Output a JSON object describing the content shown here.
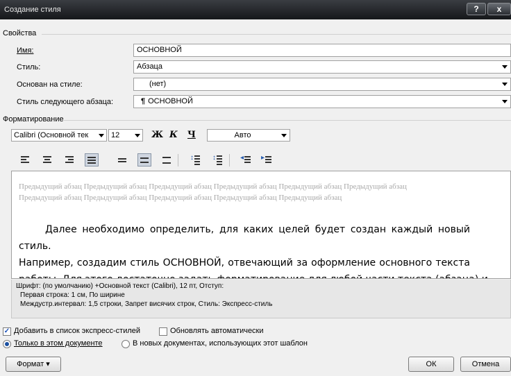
{
  "window": {
    "title": "Создание стиля",
    "help_label": "?",
    "close_label": "x"
  },
  "properties": {
    "section_title": "Свойства",
    "name_label": "Имя:",
    "name_value": "ОСНОВНОЙ",
    "style_label": "Стиль:",
    "style_value": "Абзаца",
    "based_on_label": "Основан на стиле:",
    "based_on_value": "(нет)",
    "next_style_label": "Стиль следующего абзаца:",
    "next_style_glyph": "¶",
    "next_style_value": "ОСНОВНОЙ"
  },
  "formatting": {
    "section_title": "Форматирование",
    "font_value": "Calibri (Основной тек",
    "size_value": "12",
    "bold_label": "Ж",
    "italic_label": "К",
    "underline_label": "Ч",
    "color_value": "Авто"
  },
  "preview": {
    "previous_paragraph": "Предыдущий абзац Предыдущий абзац Предыдущий абзац Предыдущий абзац Предыдущий абзац Предыдущий абзац Предыдущий абзац Предыдущий абзац Предыдущий абзац Предыдущий абзац Предыдущий абзац",
    "line1": "Далее необходимо определить, для каких целей будет создан каждый новый стиль.",
    "line2": "Например, создадим стиль ОСНОВНОЙ, отвечающий за оформление основного текста",
    "line3": "работы. Для этого достаточно задать форматирование для любой части текста (абзаца) и"
  },
  "description": {
    "line1": "Шрифт: (по умолчанию) +Основной текст (Calibri), 12 пт, Отступ:",
    "line2": "Первая строка:  1 см, По ширине",
    "line3": "Междустр.интервал:  1,5 строки, Запрет висячих строк, Стиль: Экспресс-стиль"
  },
  "options": {
    "add_to_quick_label": "Добавить в список экспресс-стилей",
    "add_to_quick_checked": true,
    "auto_update_label": "Обновлять автоматически",
    "auto_update_checked": false,
    "only_this_doc_label": "Только в этом документе",
    "new_docs_label": "В новых документах, использующих этот шаблон",
    "selected_scope": "only_this_doc"
  },
  "buttons": {
    "format_label": "Формат ▾",
    "ok_label": "ОК",
    "cancel_label": "Отмена"
  }
}
